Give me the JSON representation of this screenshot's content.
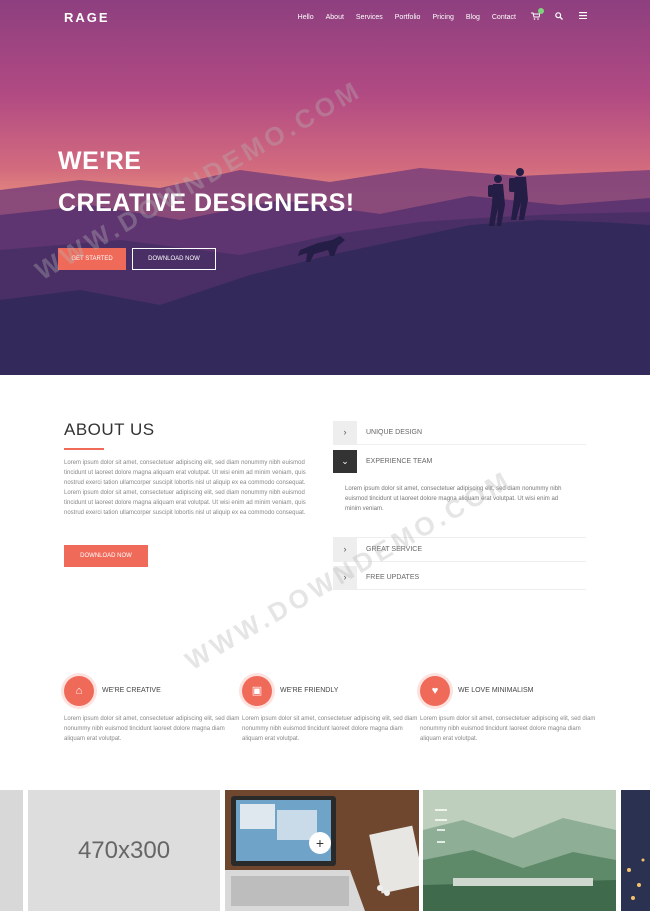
{
  "nav": {
    "logo": "RAGE",
    "items": [
      "Hello",
      "About",
      "Services",
      "Portfolio",
      "Pricing",
      "Blog",
      "Contact"
    ],
    "icons": [
      "cart-icon",
      "search-icon",
      "menu-icon"
    ]
  },
  "hero": {
    "line1": "WE'RE",
    "line2": "CREATIVE DESIGNERS!",
    "primary_button": "GET STARTED",
    "secondary_button": "DOWNLOAD NOW"
  },
  "about": {
    "title": "ABOUT US",
    "text": "Lorem ipsum dolor sit amet, consectetuer adipiscing elit, sed diam nonummy nibh euismod tincidunt ut laoreet dolore magna aliquam erat volutpat. Ut wisi enim ad minim veniam, quis nostrud exerci tation ullamcorper suscipit lobortis nisl ut aliquip ex ea commodo consequat. Lorem ipsum dolor sit amet, consectetuer adipiscing elit, sed diam nonummy nibh euismod tincidunt ut laoreet dolore magna aliquam erat volutpat. Ut wisi enim ad minim veniam, quis nostrud exerci tation ullamcorper suscipit lobortis nisl ut aliquip ex ea commodo consequat.",
    "button": "DOWNLOAD NOW"
  },
  "accordion": {
    "items": [
      {
        "label": "UNIQUE DESIGN",
        "toggle": "›"
      },
      {
        "label": "EXPERIENCE TEAM",
        "toggle": "⌄"
      },
      {
        "label": "GREAT SERVICE",
        "toggle": "›"
      },
      {
        "label": "FREE UPDATES",
        "toggle": "›"
      }
    ],
    "open_text": "Lorem ipsum dolor sit amet, consectetuer adipiscing elit, sed diam nonummy nibh euismod tincidunt ut laoreet dolore magna aliquam erat volutpat. Ut wisi enim ad minim veniam."
  },
  "features": [
    {
      "title": "WE'RE CREATIVE",
      "icon": "home-icon",
      "glyph": "⌂",
      "text": "Lorem ipsum dolor sit amet, consectetuer adipiscing elit, sed diam nonummy nibh euismod tincidunt laoreet dolore magna diam aliquam erat volutpat."
    },
    {
      "title": "WE'RE FRIENDLY",
      "icon": "bus-icon",
      "glyph": "▣",
      "text": "Lorem ipsum dolor sit amet, consectetuer adipiscing elit, sed diam nonummy nibh euismod tincidunt laoreet dolore magna diam aliquam erat volutpat."
    },
    {
      "title": "WE LOVE MINIMALISM",
      "icon": "heart-icon",
      "glyph": "♥",
      "text": "Lorem ipsum dolor sit amet, consectetuer adipiscing elit, sed diam nonummy nibh euismod tincidunt laoreet dolore magna diam aliquam erat volutpat."
    }
  ],
  "portfolio": {
    "placeholder": "470x300",
    "zoom_glyph": "+"
  },
  "colors": {
    "accent": "#f06a5a"
  },
  "watermark": "WWW.DOWNDEMO.COM"
}
